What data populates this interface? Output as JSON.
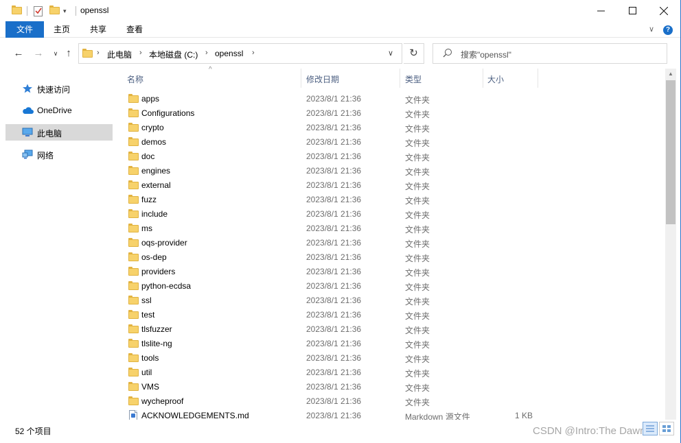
{
  "window": {
    "title": "openssl"
  },
  "ribbon": {
    "tabs": [
      "文件",
      "主页",
      "共享",
      "查看"
    ],
    "active_tab": "文件"
  },
  "navigation": {
    "breadcrumb": [
      "此电脑",
      "本地磁盘 (C:)",
      "openssl"
    ],
    "search_placeholder": "搜索\"openssl\""
  },
  "sidebar": {
    "items": [
      {
        "label": "快速访问",
        "icon": "star-icon"
      },
      {
        "label": "OneDrive",
        "icon": "cloud-icon"
      },
      {
        "label": "此电脑",
        "icon": "computer-icon"
      },
      {
        "label": "网络",
        "icon": "network-icon"
      }
    ],
    "selected": "此电脑"
  },
  "columns": {
    "name": "名称",
    "date": "修改日期",
    "type": "类型",
    "size": "大小"
  },
  "files": [
    {
      "name": "apps",
      "date": "2023/8/1 21:36",
      "type": "文件夹",
      "size": "",
      "kind": "folder"
    },
    {
      "name": "Configurations",
      "date": "2023/8/1 21:36",
      "type": "文件夹",
      "size": "",
      "kind": "folder"
    },
    {
      "name": "crypto",
      "date": "2023/8/1 21:36",
      "type": "文件夹",
      "size": "",
      "kind": "folder"
    },
    {
      "name": "demos",
      "date": "2023/8/1 21:36",
      "type": "文件夹",
      "size": "",
      "kind": "folder"
    },
    {
      "name": "doc",
      "date": "2023/8/1 21:36",
      "type": "文件夹",
      "size": "",
      "kind": "folder"
    },
    {
      "name": "engines",
      "date": "2023/8/1 21:36",
      "type": "文件夹",
      "size": "",
      "kind": "folder"
    },
    {
      "name": "external",
      "date": "2023/8/1 21:36",
      "type": "文件夹",
      "size": "",
      "kind": "folder"
    },
    {
      "name": "fuzz",
      "date": "2023/8/1 21:36",
      "type": "文件夹",
      "size": "",
      "kind": "folder"
    },
    {
      "name": "include",
      "date": "2023/8/1 21:36",
      "type": "文件夹",
      "size": "",
      "kind": "folder"
    },
    {
      "name": "ms",
      "date": "2023/8/1 21:36",
      "type": "文件夹",
      "size": "",
      "kind": "folder"
    },
    {
      "name": "oqs-provider",
      "date": "2023/8/1 21:36",
      "type": "文件夹",
      "size": "",
      "kind": "folder"
    },
    {
      "name": "os-dep",
      "date": "2023/8/1 21:36",
      "type": "文件夹",
      "size": "",
      "kind": "folder"
    },
    {
      "name": "providers",
      "date": "2023/8/1 21:36",
      "type": "文件夹",
      "size": "",
      "kind": "folder"
    },
    {
      "name": "python-ecdsa",
      "date": "2023/8/1 21:36",
      "type": "文件夹",
      "size": "",
      "kind": "folder"
    },
    {
      "name": "ssl",
      "date": "2023/8/1 21:36",
      "type": "文件夹",
      "size": "",
      "kind": "folder"
    },
    {
      "name": "test",
      "date": "2023/8/1 21:36",
      "type": "文件夹",
      "size": "",
      "kind": "folder"
    },
    {
      "name": "tlsfuzzer",
      "date": "2023/8/1 21:36",
      "type": "文件夹",
      "size": "",
      "kind": "folder"
    },
    {
      "name": "tlslite-ng",
      "date": "2023/8/1 21:36",
      "type": "文件夹",
      "size": "",
      "kind": "folder"
    },
    {
      "name": "tools",
      "date": "2023/8/1 21:36",
      "type": "文件夹",
      "size": "",
      "kind": "folder"
    },
    {
      "name": "util",
      "date": "2023/8/1 21:36",
      "type": "文件夹",
      "size": "",
      "kind": "folder"
    },
    {
      "name": "VMS",
      "date": "2023/8/1 21:36",
      "type": "文件夹",
      "size": "",
      "kind": "folder"
    },
    {
      "name": "wycheproof",
      "date": "2023/8/1 21:36",
      "type": "文件夹",
      "size": "",
      "kind": "folder"
    },
    {
      "name": "ACKNOWLEDGEMENTS.md",
      "date": "2023/8/1 21:36",
      "type": "Markdown 源文件",
      "size": "1 KB",
      "kind": "file"
    }
  ],
  "status": {
    "item_count": "52 个项目"
  },
  "watermark": "CSDN @Intro:The Dawn",
  "colors": {
    "accent": "#1a6fc9",
    "folder": "#f7d26b",
    "selected_bg": "#d9d9d9"
  }
}
